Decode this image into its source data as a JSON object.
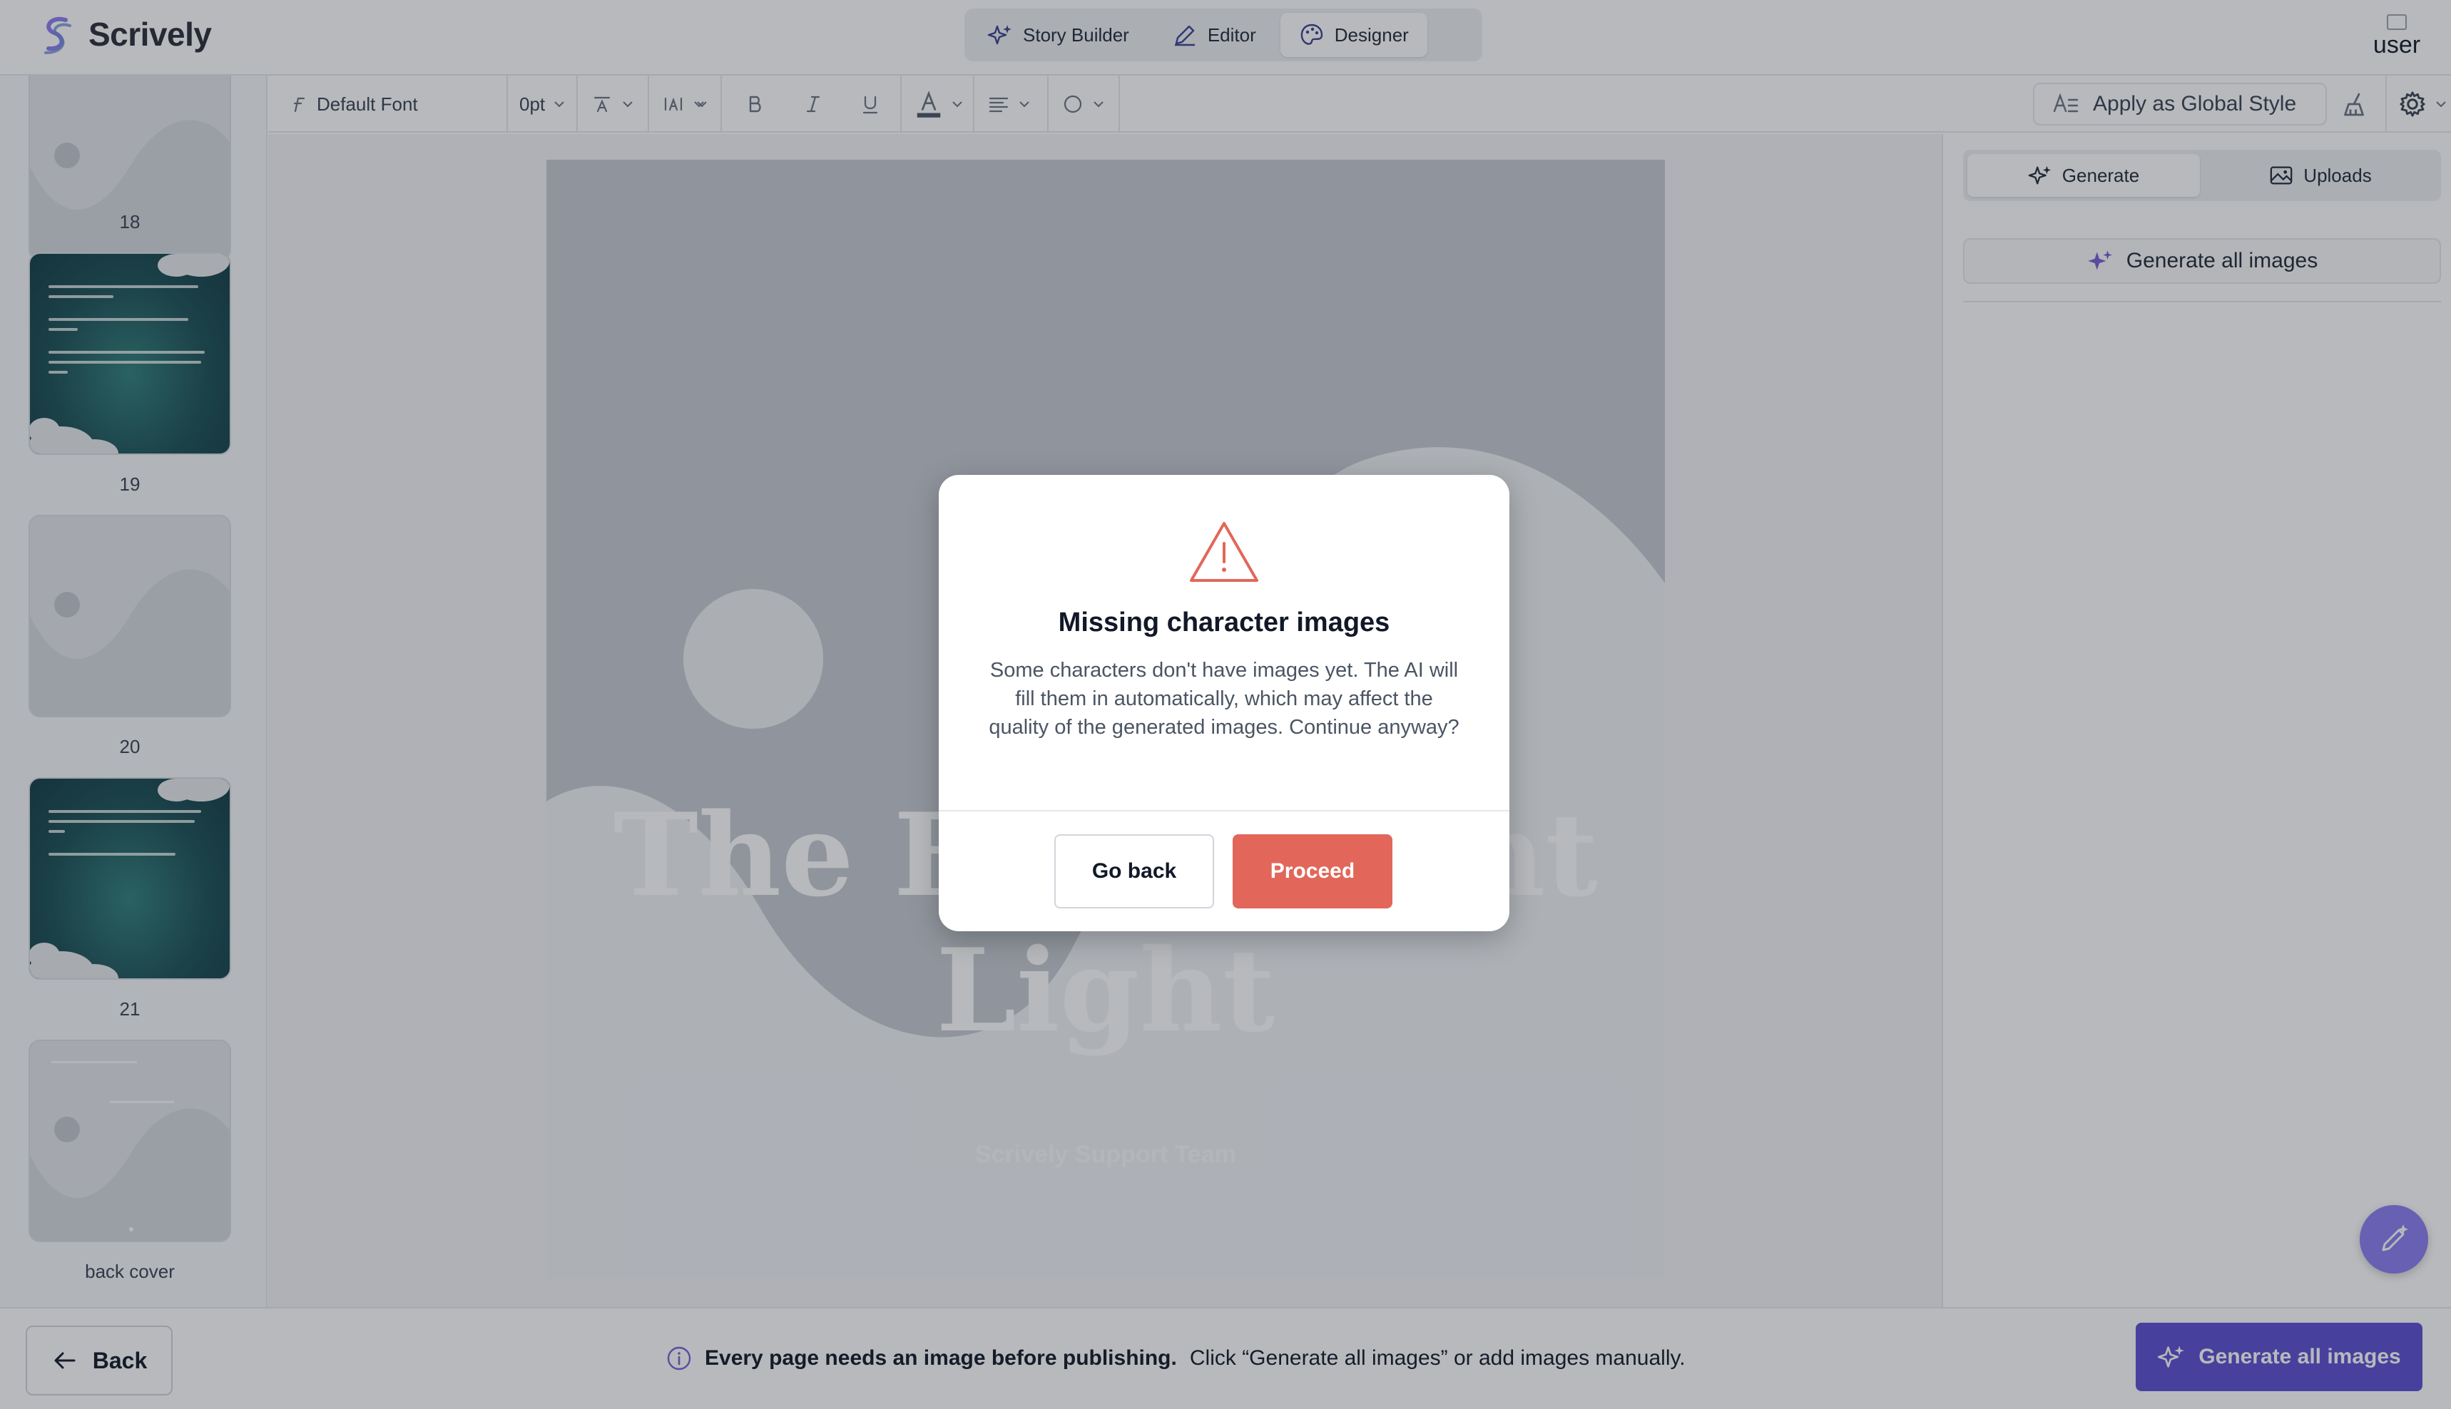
{
  "app": {
    "name": "Scrively",
    "brand_color": "#5b4fd1",
    "user_avatar_alt": "user"
  },
  "modes": [
    {
      "label": "Story Builder",
      "icon": "sparkles-icon",
      "active": false
    },
    {
      "label": "Editor",
      "icon": "pen-icon",
      "active": false
    },
    {
      "label": "Designer",
      "icon": "palette-icon",
      "active": true
    }
  ],
  "sidebar": {
    "pages": [
      {
        "label": "18",
        "style": "placeholder"
      },
      {
        "label": "19",
        "style": "teal-text"
      },
      {
        "label": "20",
        "style": "placeholder"
      },
      {
        "label": "21",
        "style": "teal-text"
      },
      {
        "label": "back cover",
        "style": "placeholder"
      }
    ]
  },
  "toolbar": {
    "font": "Default Font",
    "size": "0pt",
    "global_style_label": "Apply as Global Style"
  },
  "canvas": {
    "title": "The First Night Light",
    "author": "Scrively Support Team"
  },
  "right_panel": {
    "tabs": [
      {
        "label": "Generate",
        "active": true
      },
      {
        "label": "Uploads",
        "active": false
      }
    ],
    "generate_all_label": "Generate all images"
  },
  "bottom_bar": {
    "back_label": "Back",
    "notice_strong": "Every page needs an image before publishing.",
    "notice_text": "Click “Generate all images” or add images manually.",
    "generate_all_label": "Generate all images"
  },
  "modal": {
    "title": "Missing character images",
    "body": "Some characters don't have images yet. The AI will fill them in automatically, which may affect the quality of the generated images. Continue anyway?",
    "go_back_label": "Go back",
    "proceed_label": "Proceed",
    "warning_color": "#e2675a"
  }
}
